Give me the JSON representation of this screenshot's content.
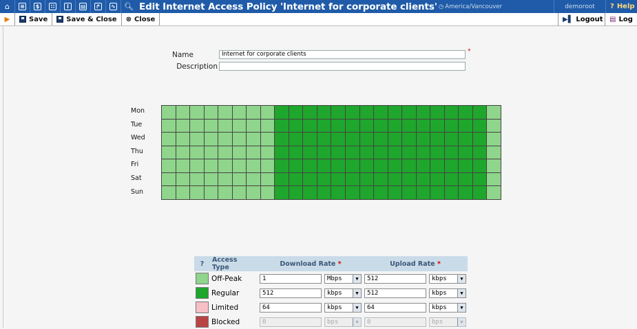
{
  "header": {
    "title": "Edit Internet Access Policy 'Internet for corporate clients'",
    "timezone": "America/Vancouver",
    "user": "demoroot",
    "help": "Help",
    "icons": [
      "home-icon",
      "list-icon",
      "dollar-icon",
      "network-icon",
      "person-icon",
      "accounts-icon",
      "arrow-box-icon",
      "chart-icon",
      "search-icon"
    ]
  },
  "toolbar": {
    "save": "Save",
    "save_close": "Save & Close",
    "close": "Close",
    "logout": "Logout",
    "log": "Log"
  },
  "form": {
    "name_label": "Name",
    "name_value": "Internet for corporate clients",
    "description_label": "Description",
    "description_value": "",
    "required_mark": "*"
  },
  "schedule": {
    "days": [
      "Mon",
      "Tue",
      "Wed",
      "Thu",
      "Fri",
      "Sat",
      "Sun"
    ],
    "hours": 24,
    "peak_start_hour": 8,
    "peak_end_hour": 23,
    "colors": {
      "offpeak": "#8fd58b",
      "regular": "#1fa62c"
    }
  },
  "legend": {
    "headers": {
      "help": "?",
      "access_type": "Access Type",
      "download": "Download Rate",
      "upload": "Upload Rate",
      "required": "*"
    },
    "rows": [
      {
        "color": "#8fd58b",
        "type": "Off-Peak",
        "down_value": "1",
        "down_unit": "Mbps",
        "up_value": "512",
        "up_unit": "kbps",
        "disabled": false
      },
      {
        "color": "#1fa62c",
        "type": "Regular",
        "down_value": "512",
        "down_unit": "kbps",
        "up_value": "512",
        "up_unit": "kbps",
        "disabled": false
      },
      {
        "color": "#f6c0c6",
        "type": "Limited",
        "down_value": "64",
        "down_unit": "kbps",
        "up_value": "64",
        "up_unit": "kbps",
        "disabled": false
      },
      {
        "color": "#b94444",
        "type": "Blocked",
        "down_value": "0",
        "down_unit": "bps",
        "up_value": "0",
        "up_unit": "bps",
        "disabled": true
      }
    ]
  }
}
